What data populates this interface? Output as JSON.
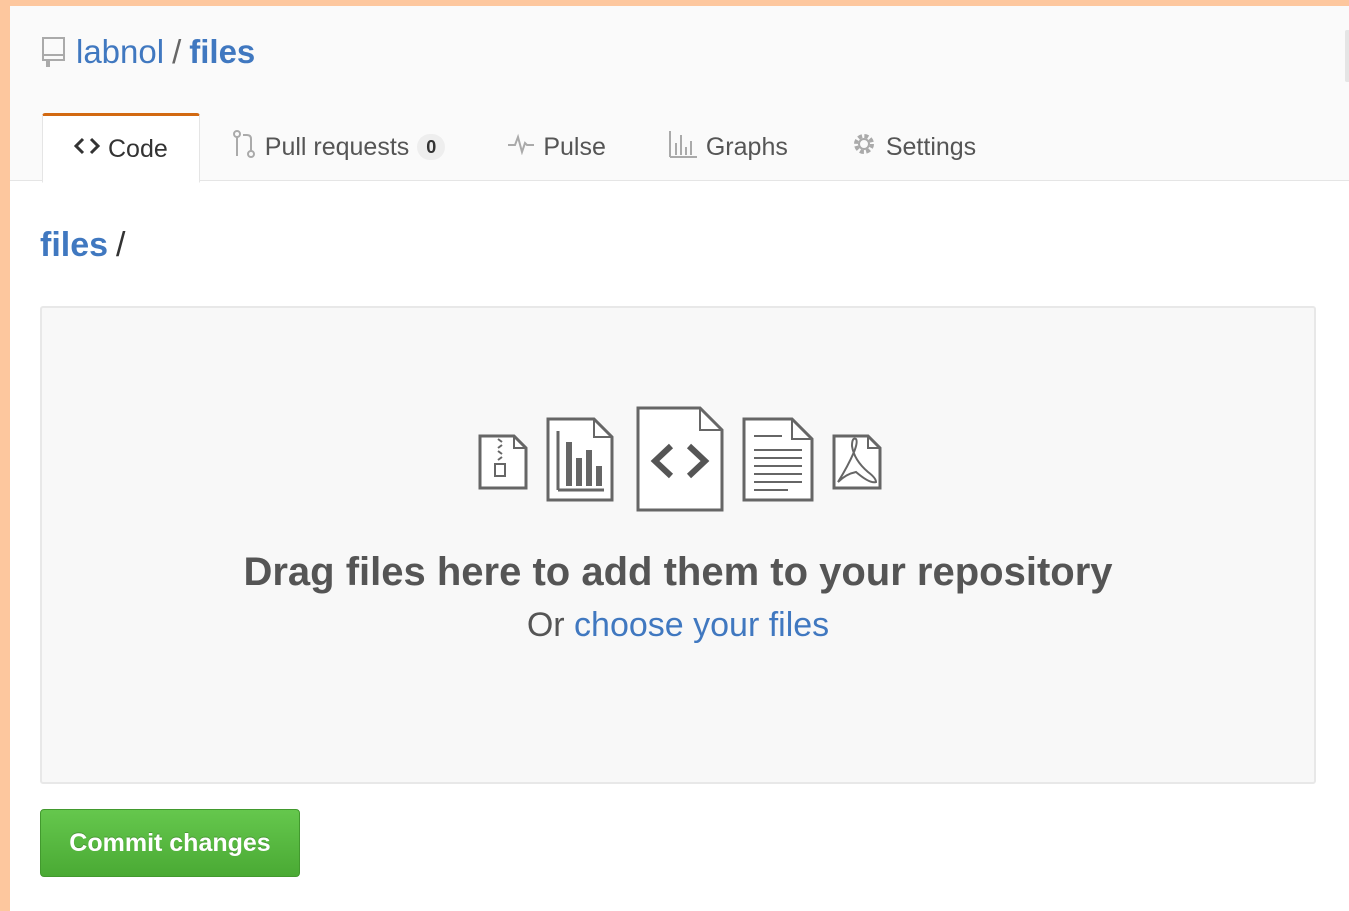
{
  "repo": {
    "owner": "labnol",
    "separator": "/",
    "name": "files",
    "icon": "repo-icon"
  },
  "tabs": [
    {
      "label": "Code",
      "icon": "code-icon",
      "selected": true
    },
    {
      "label": "Pull requests",
      "icon": "pull-request-icon",
      "count": "0",
      "selected": false
    },
    {
      "label": "Pulse",
      "icon": "pulse-icon",
      "selected": false
    },
    {
      "label": "Graphs",
      "icon": "graph-icon",
      "selected": false
    },
    {
      "label": "Settings",
      "icon": "gear-icon",
      "selected": false
    }
  ],
  "breadcrumb": {
    "root": "files",
    "separator": "/"
  },
  "dropzone": {
    "title": "Drag files here to add them to your repository",
    "or_text": "Or",
    "choose_link": "choose your files",
    "icons": [
      "zip-file-icon",
      "chart-file-icon",
      "code-file-icon",
      "text-file-icon",
      "pdf-file-icon"
    ]
  },
  "commit_button": "Commit changes",
  "colors": {
    "link": "#4078c0",
    "tab_accent": "#d26911",
    "commit_green": "#55b83f",
    "background_outer": "#fdc79e"
  }
}
